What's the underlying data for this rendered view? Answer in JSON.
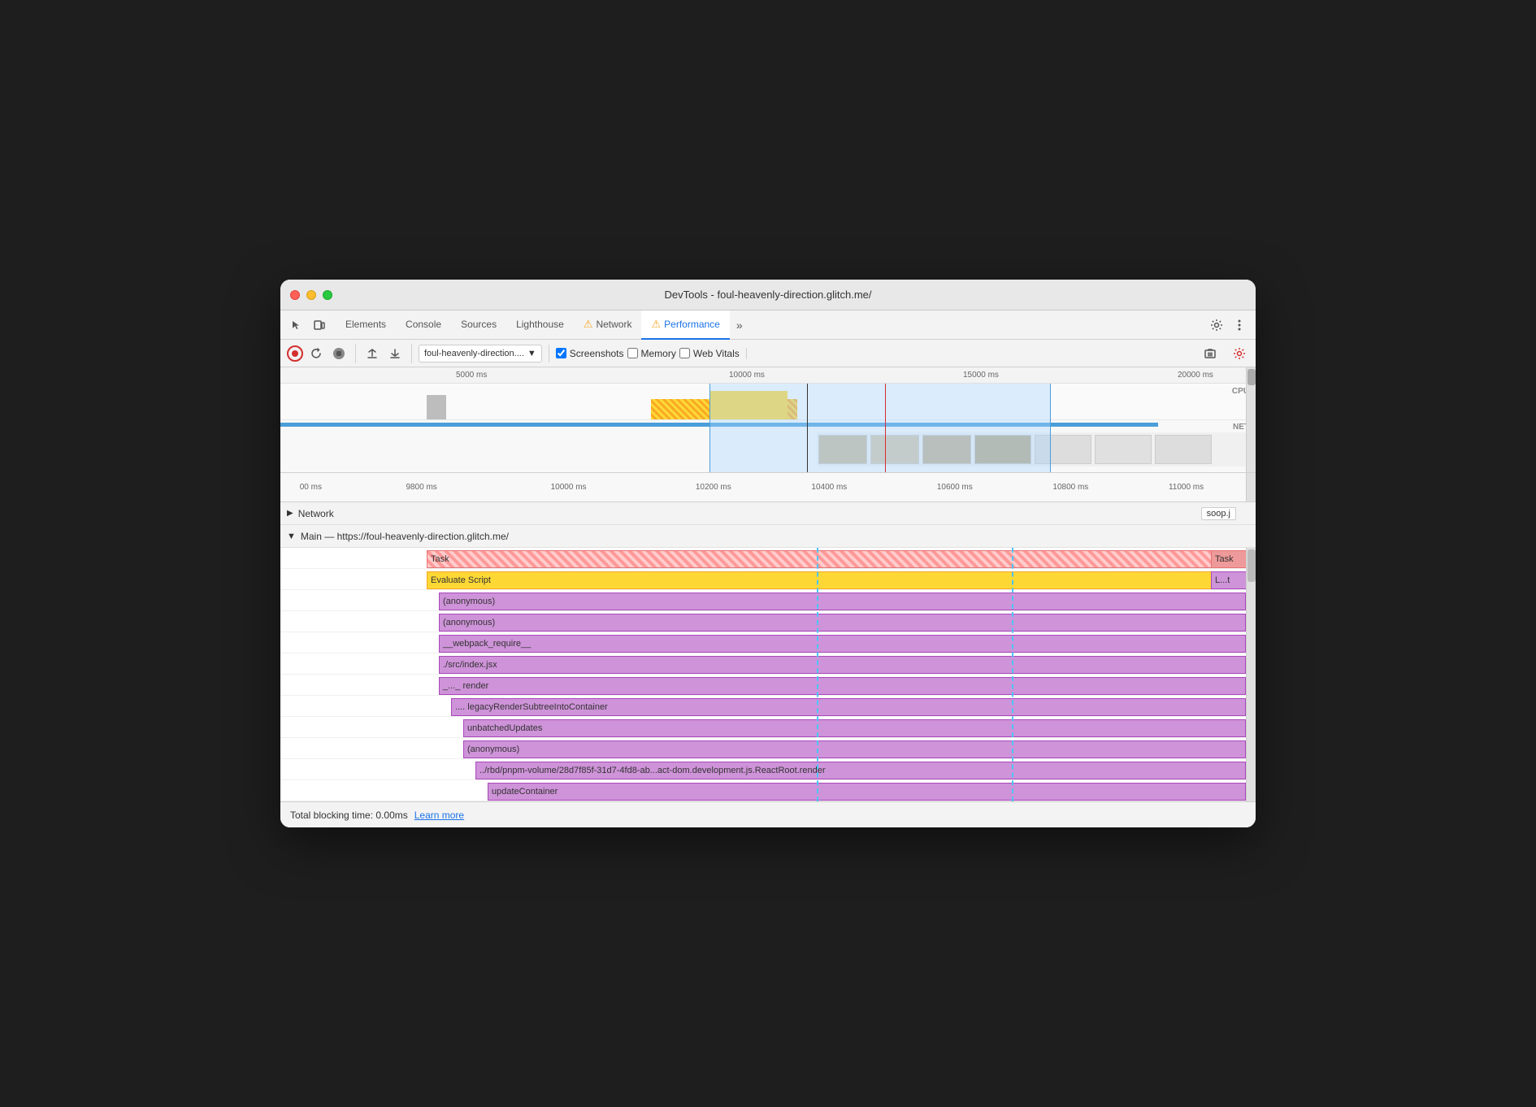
{
  "window": {
    "title": "DevTools - foul-heavenly-direction.glitch.me/"
  },
  "tabs": [
    {
      "id": "elements",
      "label": "Elements",
      "active": false,
      "warning": false
    },
    {
      "id": "console",
      "label": "Console",
      "active": false,
      "warning": false
    },
    {
      "id": "sources",
      "label": "Sources",
      "active": false,
      "warning": false
    },
    {
      "id": "lighthouse",
      "label": "Lighthouse",
      "active": false,
      "warning": false
    },
    {
      "id": "network",
      "label": "Network",
      "active": false,
      "warning": true
    },
    {
      "id": "performance",
      "label": "Performance",
      "active": true,
      "warning": true
    }
  ],
  "toolbar": {
    "record_label": "Record",
    "reload_label": "Reload",
    "clear_label": "Clear",
    "upload_label": "Upload",
    "download_label": "Download",
    "url_value": "foul-heavenly-direction....",
    "screenshots_label": "Screenshots",
    "memory_label": "Memory",
    "web_vitals_label": "Web Vitals",
    "screenshots_checked": true,
    "memory_checked": false,
    "web_vitals_checked": false
  },
  "timeline": {
    "overview_marks": [
      "5000 ms",
      "10000 ms",
      "15000 ms",
      "20000 ms"
    ],
    "zoom_marks": [
      "00 ms",
      "9800 ms",
      "10000 ms",
      "10200 ms",
      "10400 ms",
      "10600 ms",
      "10800 ms",
      "11000 ms"
    ]
  },
  "network_section": {
    "label": "Network",
    "filename": "soop.j"
  },
  "flame_chart": {
    "main_label": "Main — https://foul-heavenly-direction.glitch.me/",
    "rows": [
      {
        "label": "Task",
        "type": "task",
        "end_label": "Task"
      },
      {
        "label": "Evaluate Script",
        "type": "eval-script",
        "end_label": "L...t"
      },
      {
        "label": "(anonymous)",
        "type": "purple"
      },
      {
        "label": "(anonymous)",
        "type": "purple"
      },
      {
        "label": "__webpack_require__",
        "type": "purple"
      },
      {
        "label": "./src/index.jsx",
        "type": "purple"
      },
      {
        "label": "_..._ render",
        "type": "purple"
      },
      {
        "label": ".... legacyRenderSubtreeIntoContainer",
        "type": "purple"
      },
      {
        "label": "unbatchedUpdates",
        "type": "purple"
      },
      {
        "label": "(anonymous)",
        "type": "purple"
      },
      {
        "label": "../rbd/pnpm-volume/28d7f85f-31d7-4fd8-ab...act-dom.development.js.ReactRoot.render",
        "type": "purple"
      },
      {
        "label": "updateContainer",
        "type": "purple"
      }
    ]
  },
  "status_bar": {
    "blocking_time_label": "Total blocking time: 0.00ms",
    "learn_more_label": "Learn more"
  }
}
